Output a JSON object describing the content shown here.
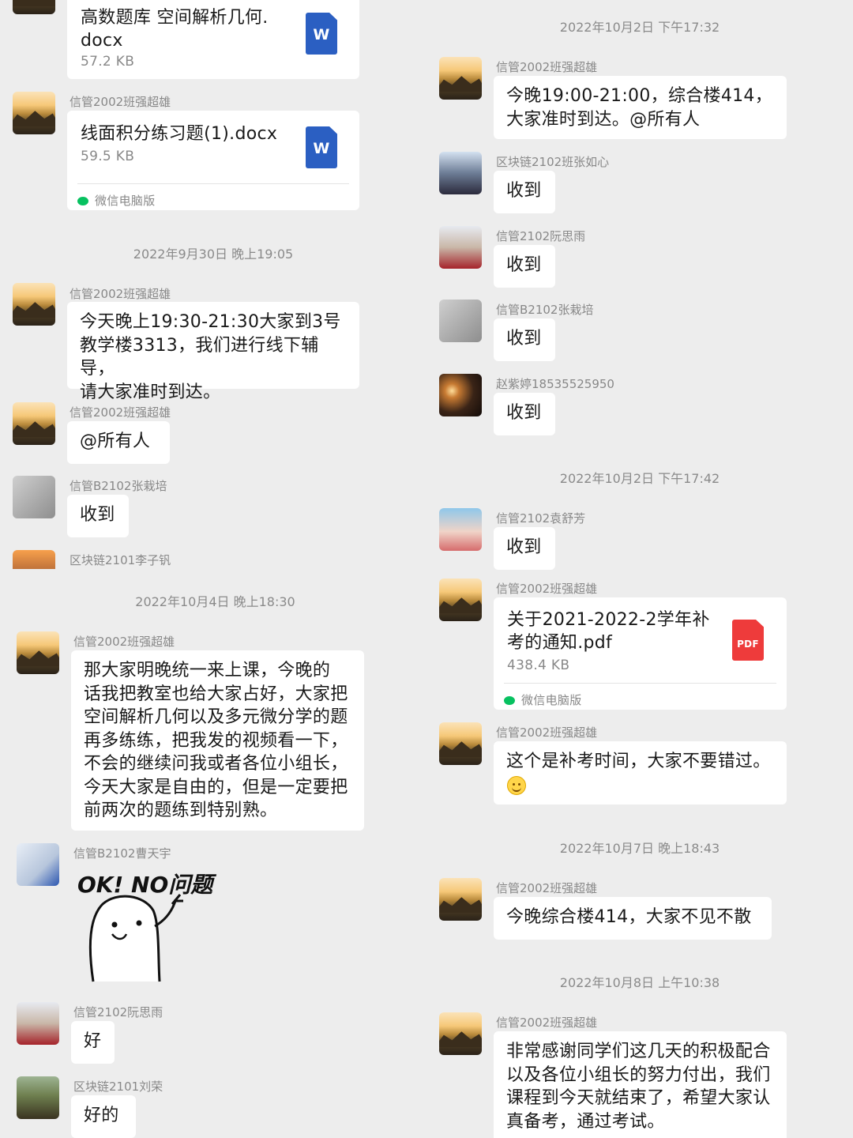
{
  "top_left": {
    "file1": {
      "name": "高数题库 空间解析几何.\ndocx",
      "size": "57.2 KB",
      "icon": "W"
    },
    "sender_file2": "信管2002班强超雄",
    "file2": {
      "name": "线面积分练习题(1).docx",
      "size": "59.5 KB",
      "icon": "W",
      "source": "微信电脑版"
    },
    "ts_1": "2022年9月30日 晚上19:05",
    "sender_m1": "信管2002班强超雄",
    "m1": "今天晚上19:30-21:30大家到3号\n教学楼3313，我们进行线下辅导，\n请大家准时到达。",
    "sender_m2": "信管2002班强超雄",
    "m2": "@所有人",
    "sender_m3": "信管B2102张栽培",
    "m3": "收到",
    "sender_m4": "区块链2101李子钒"
  },
  "bottom_left": {
    "ts_1": "2022年10月4日 晚上18:30",
    "sender_m1": "信管2002班强超雄",
    "m1": "那大家明晚统一来上课，今晚的\n话我把教室也给大家占好，大家把\n空间解析几何以及多元微分学的题\n再多练练，把我发的视频看一下，\n不会的继续问我或者各位小组长，\n今天大家是自由的，但是一定要把\n前两次的题练到特别熟。",
    "sender_m2": "信管B2102曹天宇",
    "sticker_text": "OK! NO问题",
    "sender_m3": "信管2102阮思雨",
    "m3": "好",
    "sender_m4": "区块链2101刘荣",
    "m4": "好的"
  },
  "right": {
    "ts_1": "2022年10月2日 下午17:32",
    "sender_m1": "信管2002班强超雄",
    "m1": "今晚19:00-21:00，综合楼414，\n大家准时到达。@所有人",
    "sender_m2": "区块链2102班张如心",
    "m2": "收到",
    "sender_m3": "信管2102阮思雨",
    "m3": "收到",
    "sender_m4": "信管B2102张栽培",
    "m4": "收到",
    "sender_m5": "赵紫婷18535525950",
    "m5": "收到",
    "ts_2": "2022年10月2日 下午17:42",
    "sender_m6": "信管2102袁舒芳",
    "m6": "收到",
    "sender_m7": "信管2002班强超雄",
    "file": {
      "name": "关于2021-2022-2学年补\n考的通知.pdf",
      "size": "438.4 KB",
      "icon": "PDF",
      "source": "微信电脑版"
    },
    "sender_m8": "信管2002班强超雄",
    "m8": "这个是补考时间，大家不要错过。",
    "ts_3": "2022年10月7日 晚上18:43",
    "sender_m9": "信管2002班强超雄",
    "m9": "今晚综合楼414，大家不见不散",
    "ts_4": "2022年10月8日 上午10:38",
    "sender_m10": "信管2002班强超雄",
    "m10": "非常感谢同学们这几天的积极配合\n以及各位小组长的努力付出，我们\n课程到今天就结束了，希望大家认\n真备考，通过考试。"
  },
  "colors": {
    "background": "#ededed",
    "bubble": "#ffffff",
    "word_icon": "#2b5fc2",
    "pdf_icon": "#ee3b3b",
    "wechat_green": "#07c160"
  }
}
